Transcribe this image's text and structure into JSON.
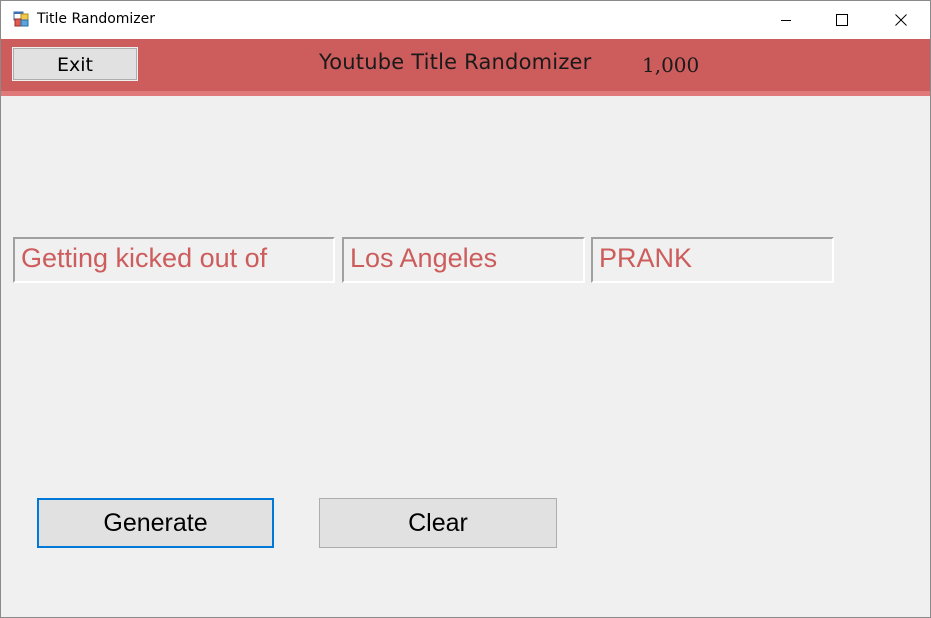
{
  "window": {
    "title": "Title Randomizer",
    "icon": "windows-form-icon",
    "controls": {
      "minimize": "minimize-icon",
      "maximize": "maximize-icon",
      "close": "close-icon"
    }
  },
  "header": {
    "exit_label": "Exit",
    "title": "Youtube Title Randomizer",
    "count": "1,000",
    "background": "#cd5c5c"
  },
  "words": [
    "Getting kicked out of",
    "Los Angeles",
    "PRANK"
  ],
  "word_color": "#cd5c5c",
  "actions": {
    "generate_label": "Generate",
    "clear_label": "Clear",
    "focus_color": "#0078d7"
  }
}
